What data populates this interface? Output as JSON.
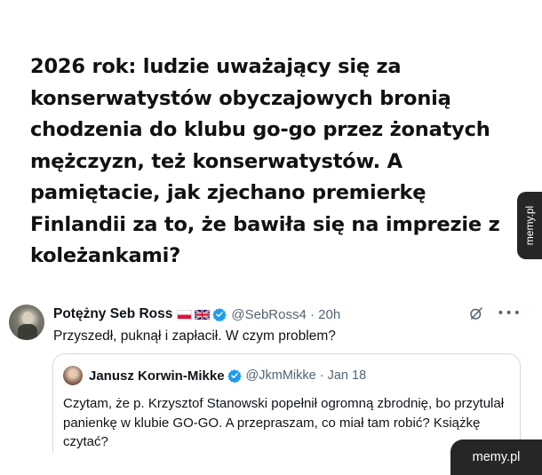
{
  "post": {
    "headline": "2026 rok: ludzie uważający się za konserwatystów obyczajowych bronią chodzenia do klubu go-go przez żonatych mężczyzn, też konserwatystów. A pamiętacie, jak zjechano premierkę Finlandii za to, że bawiła się na imprezie z koleżankami?"
  },
  "watermarks": {
    "side": "memy.pl",
    "corner": "memy.pl"
  },
  "tweet": {
    "author_name": "Potężny Seb Ross",
    "handle_time": "@SebRoss4 · 20h",
    "text": "Przyszedł, puknął i zapłacił. W czym problem?",
    "more_glyph": "•••",
    "quoted": {
      "author_name": "Janusz Korwin-Mikke",
      "handle_time": "@JkmMikke · Jan 18",
      "text": "Czytam, że p. Krzysztof Stanowski popełnił ogromną zbrodnię, bo przytulał panienkę w klubie GO-GO. A przepraszam, co miał tam robić? Książkę czytać?"
    }
  },
  "colors": {
    "verified": "#1d9bf0",
    "secondary_text": "#536471",
    "tab_bg": "#262626"
  },
  "icons": [
    "verified-badge-icon",
    "poland-flag-icon",
    "uk-flag-icon",
    "grok-icon",
    "more-icon"
  ]
}
